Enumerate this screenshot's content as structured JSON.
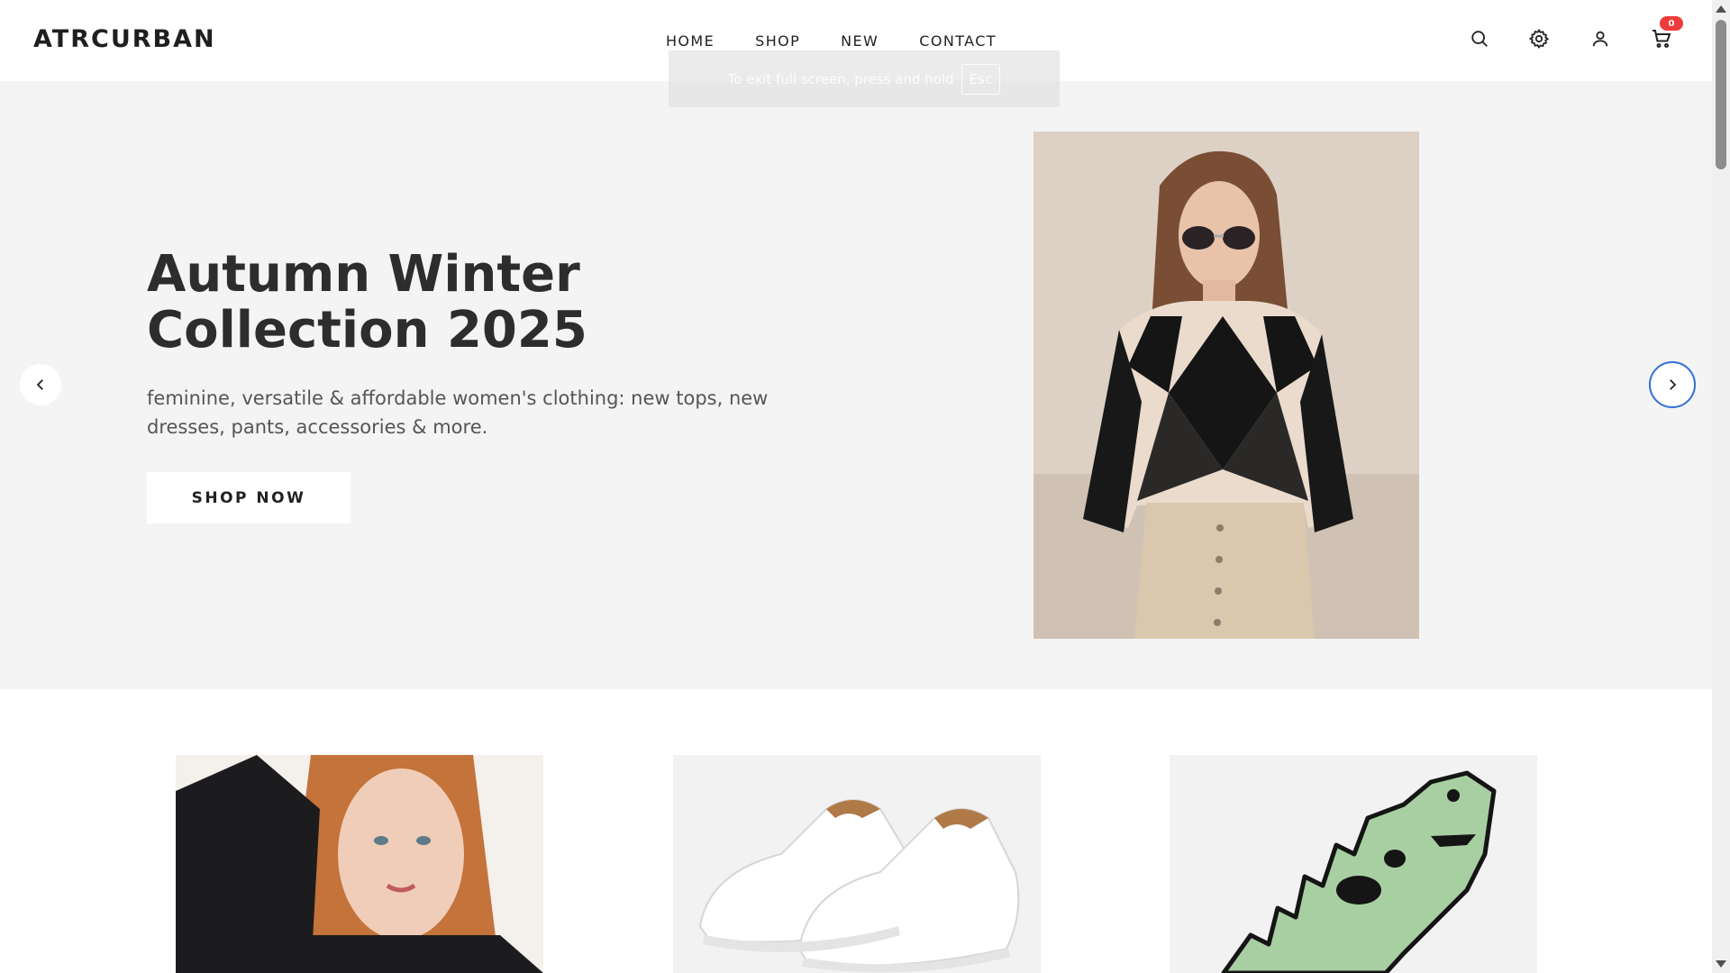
{
  "brand": {
    "logo": "ATRCURBAN"
  },
  "nav": {
    "items": [
      "HOME",
      "SHOP",
      "NEW",
      "CONTACT"
    ]
  },
  "header_icons": [
    "search-icon",
    "gear-icon",
    "user-icon",
    "cart-icon"
  ],
  "cart": {
    "count": "0"
  },
  "fullscreen_notice": {
    "text": "To exit full screen, press and hold",
    "key": "Esc"
  },
  "hero": {
    "title": "Autumn Winter Collection 2025",
    "subtitle": "feminine, versatile & affordable women's clothing: new tops, new dresses, pants, accessories & more.",
    "button": "SHOP NOW"
  },
  "slider": {
    "prev_icon": "chevron-left-icon",
    "next_icon": "chevron-right-icon"
  },
  "colors": {
    "hero_bg": "#f4f4f4",
    "badge": "#ef3b3b",
    "focus_ring": "#2f6fd6",
    "text_dark": "#2d2d2d"
  }
}
